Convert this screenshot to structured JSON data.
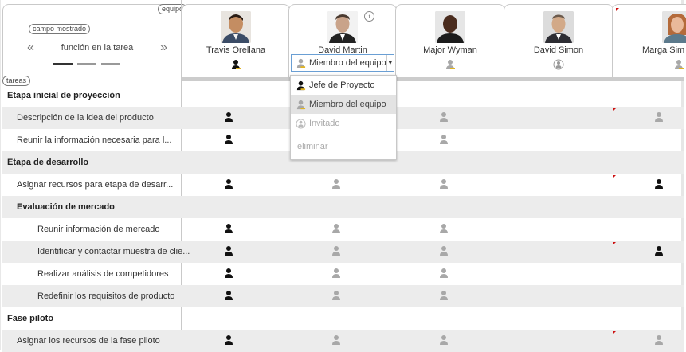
{
  "header": {
    "team_pill": "equipo",
    "field_pill": "campo mostrado",
    "tasks_pill": "tareas",
    "role_label": "función en la tarea",
    "prev_arrow": "«",
    "next_arrow": "»"
  },
  "members": [
    {
      "name": "Travis Orellana",
      "role_icon": "lead-person-icon"
    },
    {
      "name": "David Martin",
      "role_icon": "member-person-icon"
    },
    {
      "name": "Major Wyman",
      "role_icon": "member-person-icon"
    },
    {
      "name": "David Simon",
      "role_icon": "guest-person-icon"
    },
    {
      "name": "Marga Sim",
      "role_icon": "member-person-icon"
    }
  ],
  "dropdown": {
    "current": "Miembro del equipo",
    "options": [
      {
        "label": "Jefe de Proyecto",
        "icon": "lead-person-icon"
      },
      {
        "label": "Miembro del equipo",
        "icon": "member-person-icon"
      },
      {
        "label": "Invitado",
        "icon": "guest-person-icon"
      }
    ],
    "remove_label": "eliminar"
  },
  "tasks": [
    {
      "label": "Etapa inicial de proyección",
      "type": "group",
      "cells": [
        "",
        "",
        "",
        "",
        ""
      ]
    },
    {
      "label": "Descripción de la idea del producto",
      "type": "task",
      "cells": [
        "dark",
        "",
        "light",
        "",
        "light"
      ]
    },
    {
      "label": "Reunir la información necesaria para l...",
      "type": "task",
      "cells": [
        "dark",
        "",
        "light",
        "",
        ""
      ]
    },
    {
      "label": "Etapa de desarrollo",
      "type": "group",
      "cells": [
        "",
        "",
        "",
        "",
        ""
      ]
    },
    {
      "label": "Asignar recursos para etapa de desarr...",
      "type": "task",
      "cells": [
        "dark",
        "light",
        "light",
        "",
        "dark"
      ]
    },
    {
      "label": "Evaluación de mercado",
      "type": "subgroup",
      "cells": [
        "",
        "",
        "",
        "",
        ""
      ]
    },
    {
      "label": "Reunir información de mercado",
      "type": "subtask",
      "cells": [
        "dark",
        "light",
        "light",
        "",
        ""
      ]
    },
    {
      "label": "Identificar y contactar muestra de clie...",
      "type": "subtask",
      "cells": [
        "dark",
        "light",
        "light",
        "",
        "dark"
      ]
    },
    {
      "label": "Realizar análisis de competidores",
      "type": "subtask",
      "cells": [
        "dark",
        "light",
        "light",
        "",
        ""
      ]
    },
    {
      "label": "Redefinir los requisitos de producto",
      "type": "subtask",
      "cells": [
        "dark",
        "light",
        "light",
        "",
        ""
      ]
    },
    {
      "label": "Fase piloto",
      "type": "group",
      "cells": [
        "",
        "",
        "",
        "",
        ""
      ]
    },
    {
      "label": "Asignar los recursos de la fase piloto",
      "type": "task",
      "cells": [
        "dark",
        "light",
        "light",
        "",
        "light"
      ]
    }
  ],
  "colors": {
    "dark": "#111111",
    "light": "#a8a8a8",
    "accent": "#e1b422",
    "flag": "#cc1111"
  }
}
